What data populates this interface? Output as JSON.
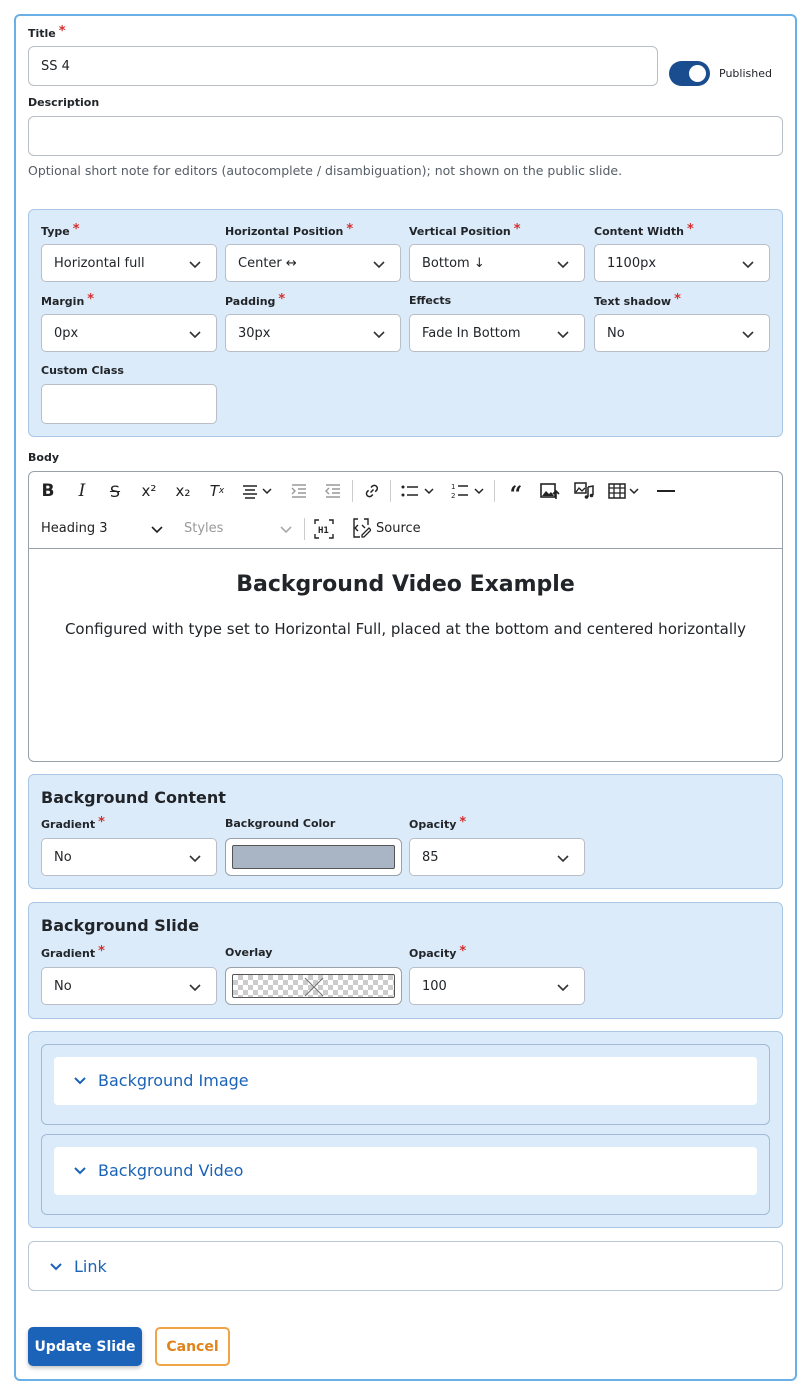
{
  "title_field": {
    "label": "Title",
    "value": "SS 4"
  },
  "published": {
    "label": "Published",
    "on": true
  },
  "description": {
    "label": "Description",
    "value": "",
    "help": "Optional short note for editors (autocomplete / disambiguation); not shown on the public slide."
  },
  "layout": {
    "type": {
      "label": "Type",
      "value": "Horizontal full"
    },
    "hpos": {
      "label": "Horizontal Position",
      "value": "Center ↔"
    },
    "vpos": {
      "label": "Vertical Position",
      "value": "Bottom ↓"
    },
    "width": {
      "label": "Content Width",
      "value": "1100px"
    },
    "margin": {
      "label": "Margin",
      "value": "0px"
    },
    "padding": {
      "label": "Padding",
      "value": "30px"
    },
    "effects": {
      "label": "Effects",
      "value": "Fade In Bottom"
    },
    "shadow": {
      "label": "Text shadow",
      "value": "No"
    },
    "custom_class": {
      "label": "Custom Class",
      "value": ""
    }
  },
  "body": {
    "label": "Body",
    "heading_select": "Heading 3",
    "styles_select": "Styles",
    "source_label": "Source",
    "heading": "Background Video Example",
    "paragraph": "Configured with type set to Horizontal Full, placed at the bottom and centered horizontally"
  },
  "bg_content": {
    "title": "Background Content",
    "gradient_label": "Gradient",
    "gradient_value": "No",
    "color_label": "Background Color",
    "color": "#a9b4c4",
    "opacity_label": "Opacity",
    "opacity_value": "85"
  },
  "bg_slide": {
    "title": "Background Slide",
    "gradient_label": "Gradient",
    "gradient_value": "No",
    "overlay_label": "Overlay",
    "opacity_label": "Opacity",
    "opacity_value": "100"
  },
  "accordions": {
    "image": "Background Image",
    "video": "Background Video",
    "link": "Link"
  },
  "actions": {
    "update": "Update Slide",
    "cancel": "Cancel"
  },
  "colors": {
    "primary": "#1a63b8",
    "panel": "#dcebf9",
    "cancel": "#f0a347",
    "required": "#d32f2f"
  }
}
